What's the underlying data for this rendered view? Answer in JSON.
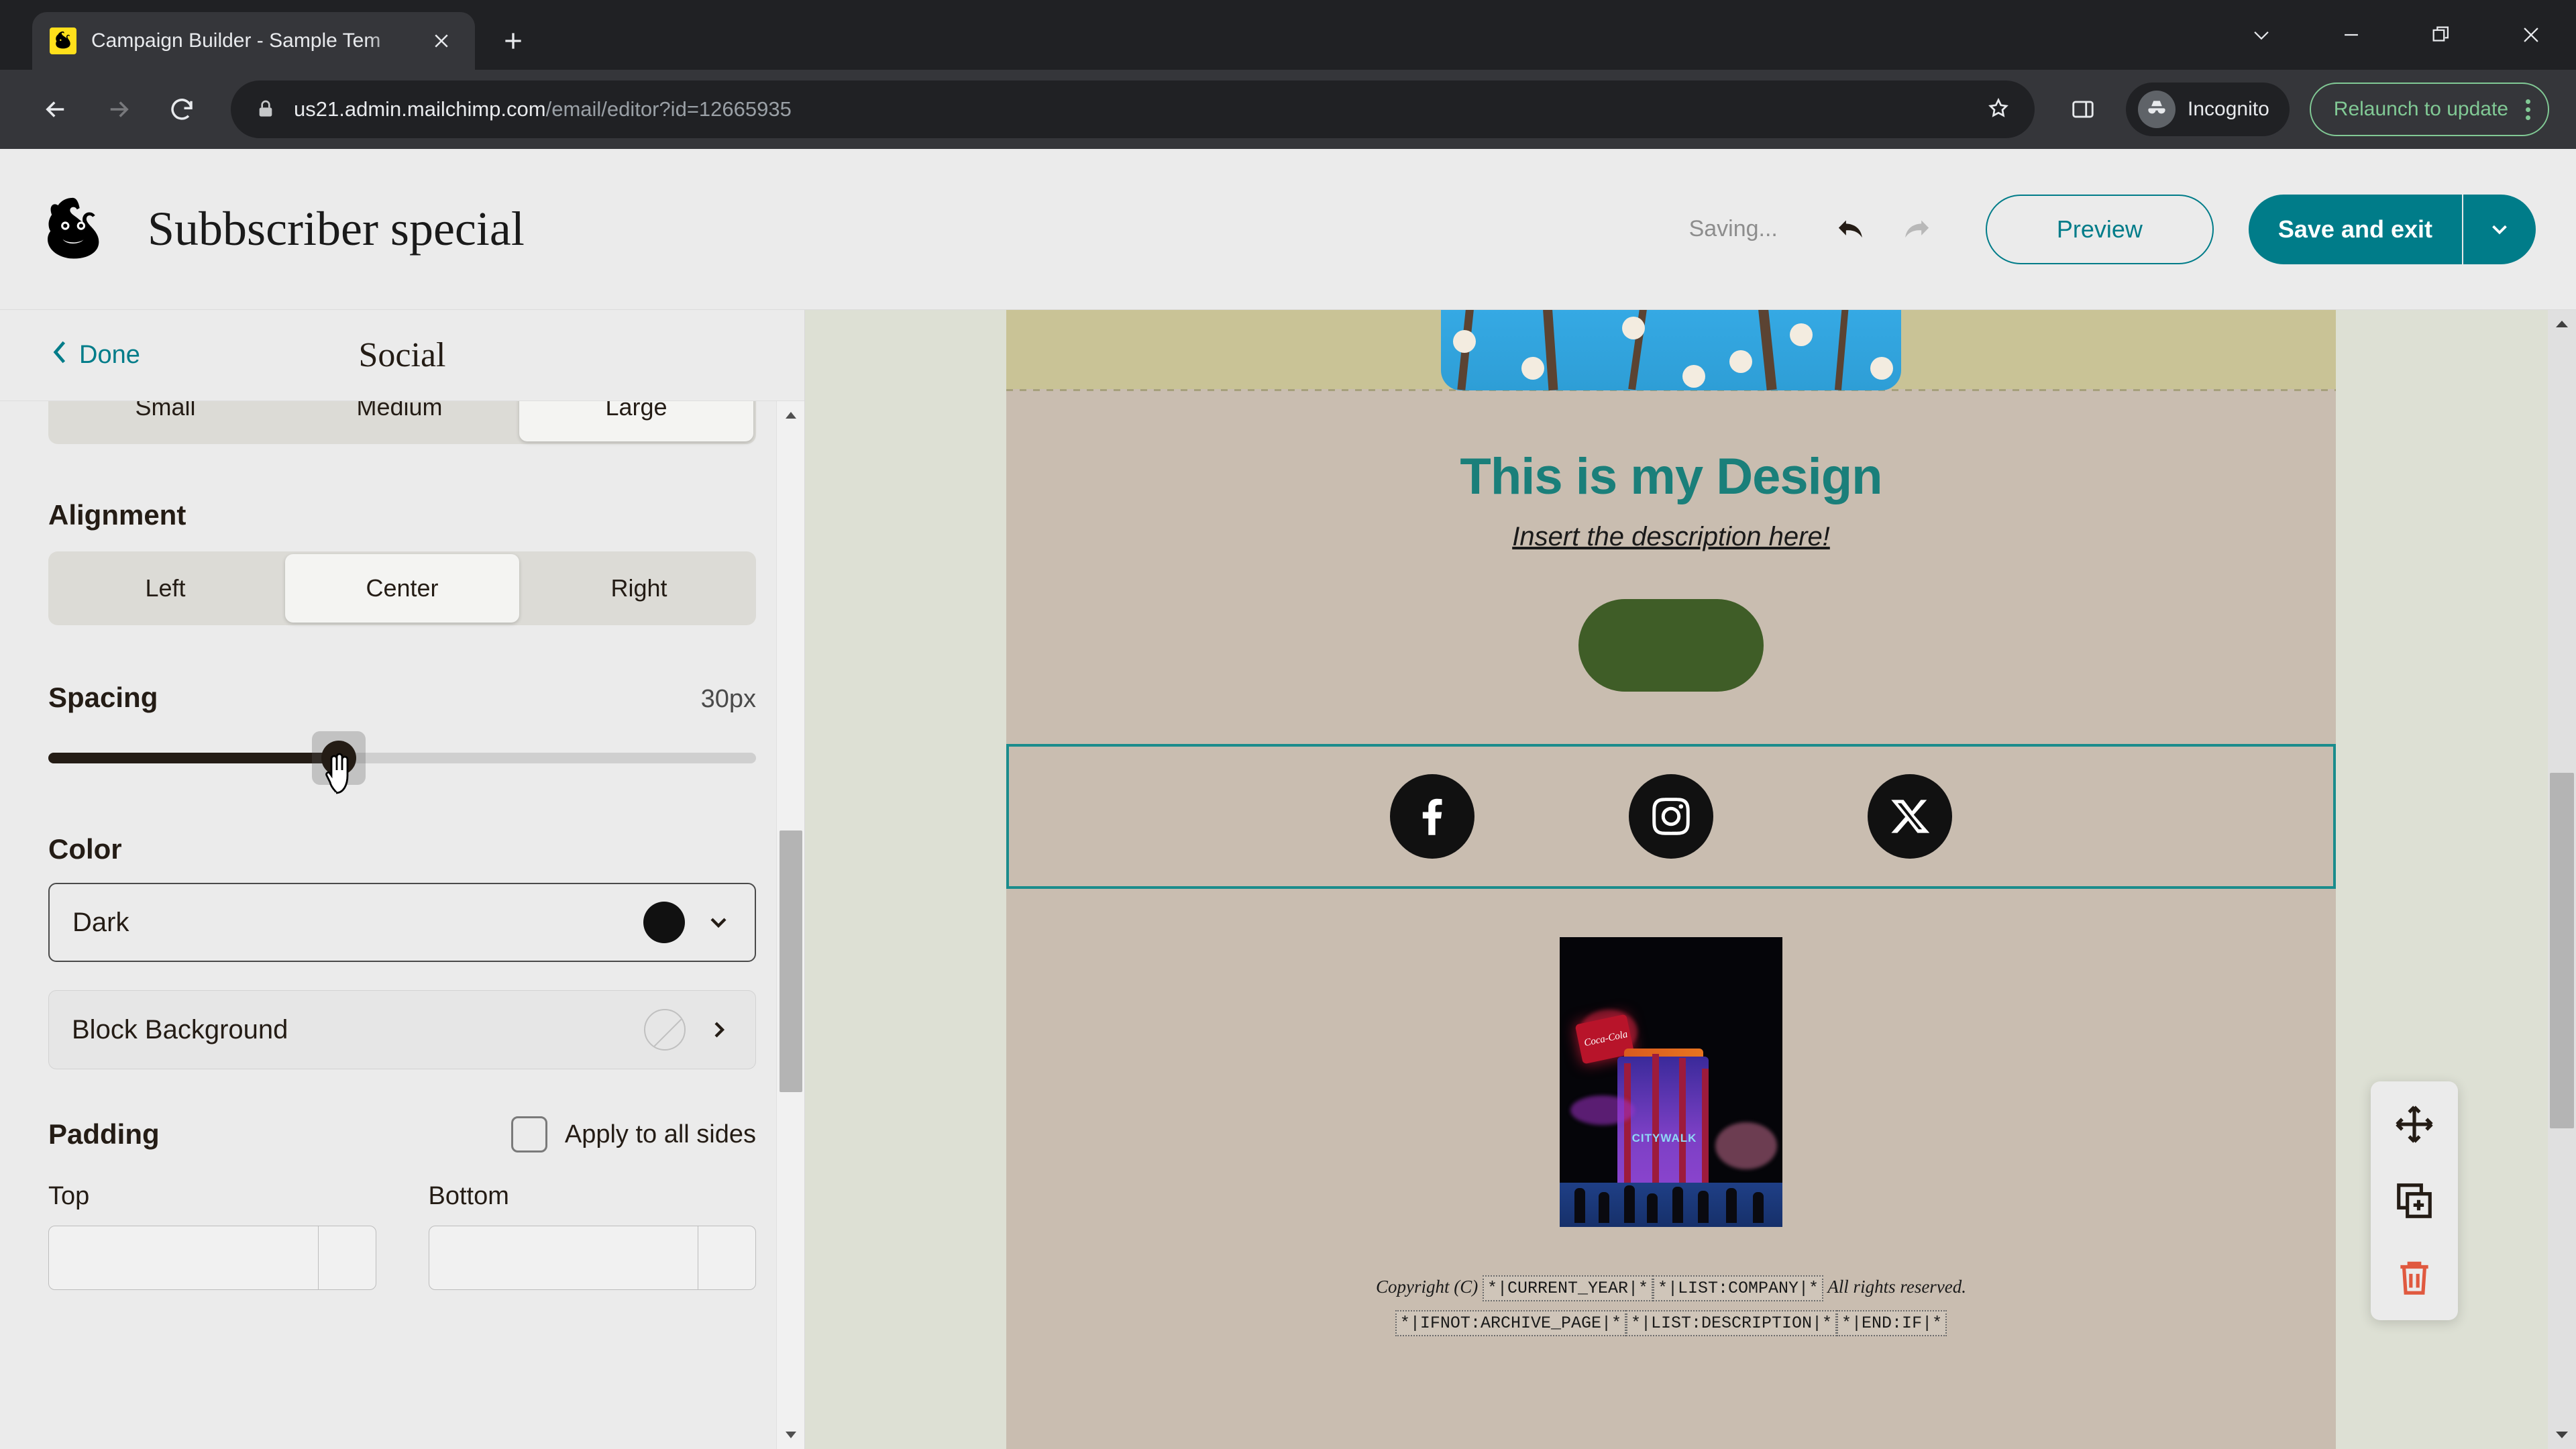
{
  "browser": {
    "tab": {
      "title": "Campaign Builder - Sample Tem",
      "favicon": "mailchimp-favicon",
      "close": "×"
    },
    "new_tab_label": "+",
    "window_controls": {
      "collapse": "chevron-down",
      "minimize": "minimize",
      "restore": "restore",
      "close": "close"
    },
    "nav": {
      "back": "back-arrow",
      "forward": "forward-arrow",
      "reload": "reload-arrow"
    },
    "address": {
      "lock": "lock-icon",
      "host": "us21.admin.mailchimp.com",
      "path": "/email/editor?id=12665935"
    },
    "bookmark_star": "star-icon",
    "side_panel": "side-panel-icon",
    "profile": {
      "label": "Incognito",
      "icon": "incognito-icon"
    },
    "update": {
      "label": "Relaunch to update",
      "menu": "three-dot-menu"
    }
  },
  "app": {
    "logo": "mailchimp-logo",
    "title": "Subbscriber special",
    "status": "Saving...",
    "undo": "undo-icon",
    "redo": "redo-icon",
    "preview_label": "Preview",
    "save_label": "Save and exit",
    "save_caret": "chevron-down-icon"
  },
  "sidebar": {
    "done_label": "Done",
    "panel_title": "Social",
    "size": {
      "options": [
        "Small",
        "Medium",
        "Large"
      ],
      "selected": "Large"
    },
    "alignment": {
      "label": "Alignment",
      "options": [
        "Left",
        "Center",
        "Right"
      ],
      "selected": "Center"
    },
    "spacing": {
      "label": "Spacing",
      "value": "30px",
      "percent": 41
    },
    "color": {
      "label": "Color",
      "selected": "Dark",
      "swatch_hex": "#111111"
    },
    "block_background": {
      "label": "Block Background",
      "swatch": "none"
    },
    "padding": {
      "label": "Padding",
      "apply_all_label": "Apply to all sides",
      "apply_all_checked": false,
      "top_label": "Top",
      "bottom_label": "Bottom",
      "top_value": "",
      "bottom_value": ""
    }
  },
  "email": {
    "heading": "This is my Design",
    "description": "Insert the description here!",
    "button_label": "",
    "social_icons": [
      {
        "name": "facebook",
        "label": "Facebook"
      },
      {
        "name": "instagram",
        "label": "Instagram"
      },
      {
        "name": "x-twitter",
        "label": "X"
      }
    ],
    "photo_caption": "CITYWALK",
    "photo_brand": "Coca-Cola",
    "footer": {
      "line1_prefix": "Copyright (C)",
      "merge_current_year": "*|CURRENT_YEAR|*",
      "merge_list_company": "*|LIST:COMPANY|*",
      "line1_suffix": "All rights reserved.",
      "merge_ifnot_archive": "*|IFNOT:ARCHIVE_PAGE|*",
      "merge_list_description": "*|LIST:DESCRIPTION|*",
      "merge_end_if": "*|END:IF|*"
    }
  },
  "float_tools": {
    "move": "move-icon",
    "duplicate": "duplicate-icon",
    "delete": "trash-icon"
  },
  "colors": {
    "accent_teal": "#007c89",
    "heading_teal": "#1a7f7a",
    "selection_teal": "#1a8c8c",
    "email_bg": "#c9bdb0",
    "band_bg": "#c9c396",
    "button_green": "#3f5d27",
    "delete_red": "#e0593f",
    "update_green": "#81c995"
  }
}
